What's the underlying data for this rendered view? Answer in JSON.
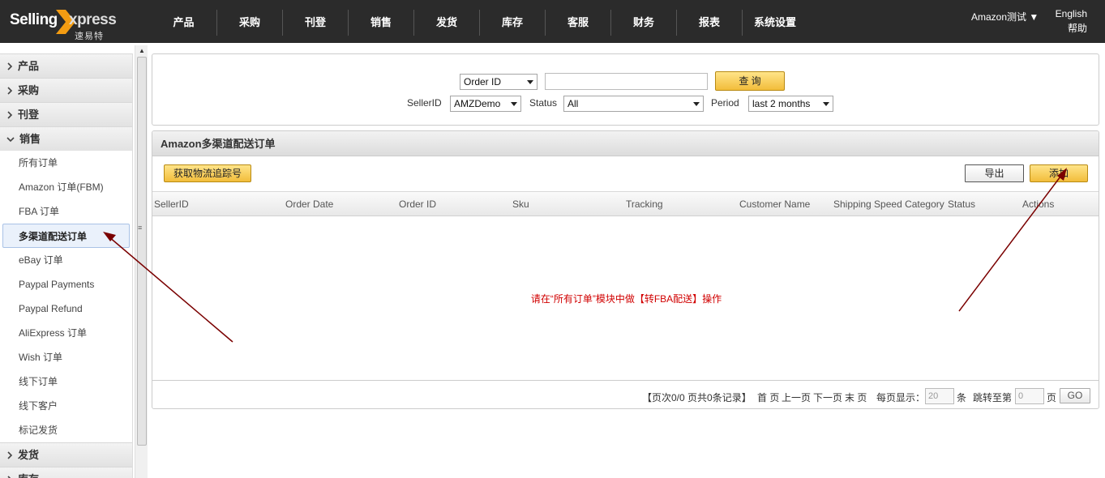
{
  "header": {
    "logo_text_1": "Selling",
    "logo_text_2": "xpress",
    "logo_sub": "速易特",
    "nav": [
      "产品",
      "采购",
      "刊登",
      "销售",
      "发货",
      "库存",
      "客服",
      "财务",
      "报表",
      "系统设置"
    ],
    "account": "Amazon测试 ▼",
    "language": "English",
    "help": "帮助"
  },
  "sidebar": {
    "groups_top": [
      {
        "label": "产品",
        "expanded": false
      },
      {
        "label": "采购",
        "expanded": false
      },
      {
        "label": "刊登",
        "expanded": false
      },
      {
        "label": "销售",
        "expanded": true
      }
    ],
    "items": [
      {
        "label": "所有订单",
        "active": false
      },
      {
        "label": "Amazon 订单(FBM)",
        "active": false
      },
      {
        "label": "FBA 订单",
        "active": false
      },
      {
        "label": "多渠道配送订单",
        "active": true
      },
      {
        "label": "eBay 订单",
        "active": false
      },
      {
        "label": "Paypal Payments",
        "active": false
      },
      {
        "label": "Paypal Refund",
        "active": false
      },
      {
        "label": "AliExpress 订单",
        "active": false
      },
      {
        "label": "Wish 订单",
        "active": false
      },
      {
        "label": "线下订单",
        "active": false
      },
      {
        "label": "线下客户",
        "active": false
      },
      {
        "label": "标记发货",
        "active": false
      }
    ],
    "groups_bottom": [
      {
        "label": "发货",
        "expanded": false
      },
      {
        "label": "库存",
        "expanded": false
      }
    ]
  },
  "search": {
    "field_select": "Order ID",
    "query_value": "",
    "query_button": "查 询",
    "seller_label": "SellerID",
    "seller_value": "AMZDemo",
    "status_label": "Status",
    "status_value": "All",
    "period_label": "Period",
    "period_value": "last 2 months"
  },
  "orders": {
    "title": "Amazon多渠道配送订单",
    "track_button": "获取物流追踪号",
    "export_button": "导出",
    "add_button": "添加",
    "columns": [
      "SellerID",
      "Order Date",
      "Order ID",
      "Sku",
      "Tracking",
      "Customer Name",
      "Shipping Speed Category",
      "Status",
      "Actions"
    ],
    "empty_message": "请在“所有订单”模块中做【转FBA配送】操作"
  },
  "pager": {
    "summary": "【页次0/0   页共0条记录】",
    "first": "首 页",
    "prev": "上一页",
    "next": "下一页",
    "last": "末 页",
    "per_page_label": "每页显示：",
    "per_page_value": "20",
    "per_page_unit": "条",
    "jump_label": "跳转至第",
    "jump_value": "0",
    "jump_unit": "页",
    "go_button": "GO"
  },
  "colors": {
    "topbar": "#2b2b2b",
    "logo_orange": "#f39c12",
    "button_yellow": "#f2bd3b",
    "annotation_arrow": "#7a0000",
    "empty_message": "#d10000"
  }
}
